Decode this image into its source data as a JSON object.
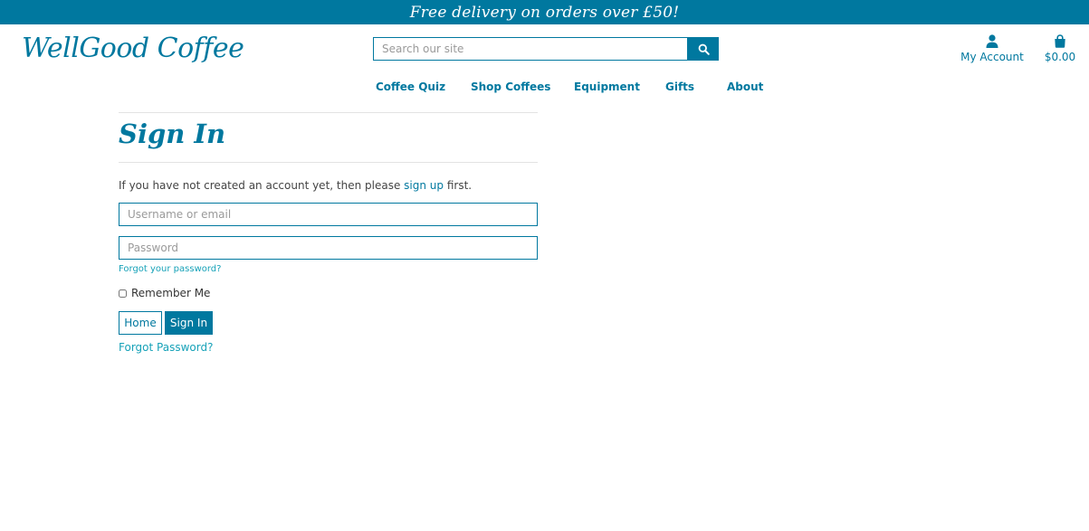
{
  "promo": {
    "text": "Free delivery on orders over £50!"
  },
  "header": {
    "logo": "WellGood Coffee",
    "search_placeholder": "Search our site",
    "account_label": "My Account",
    "cart_total": "$0.00"
  },
  "nav": {
    "items": [
      "Coffee Quiz",
      "Shop Coffees",
      "Equipment",
      "Gifts",
      "About"
    ]
  },
  "signin": {
    "title": "Sign In",
    "intro_before": "If you have not created an account yet, then please ",
    "intro_link": "sign up",
    "intro_after": " first.",
    "username_placeholder": "Username or email",
    "password_placeholder": "Password",
    "forgot_small": "Forgot your password?",
    "remember_label": "Remember Me",
    "home_button": "Home",
    "signin_button": "Sign In",
    "forgot_link": "Forgot Password?"
  },
  "colors": {
    "brand": "#00789f",
    "link": "#17a2b8"
  },
  "icons": {
    "search": "search-icon",
    "account": "user-icon",
    "cart": "shopping-bag-icon"
  }
}
